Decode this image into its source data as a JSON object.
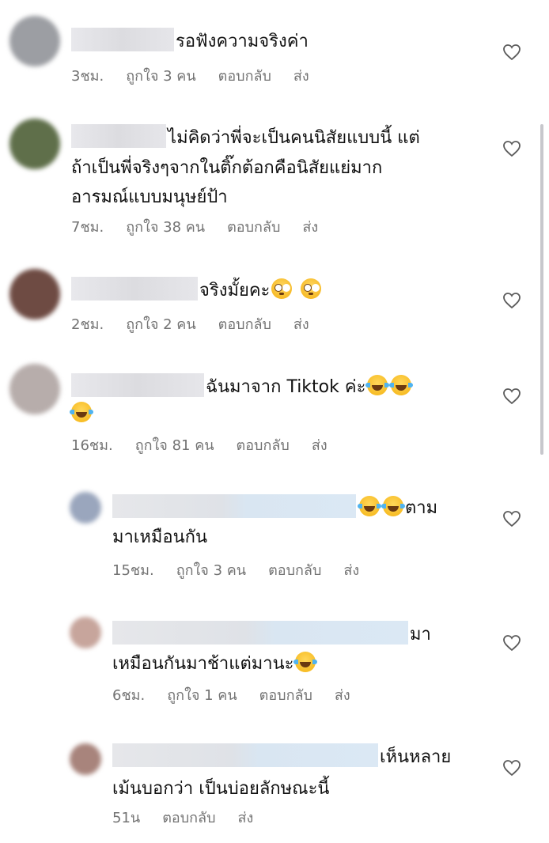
{
  "comments": [
    {
      "text": "รอฟังความจริงค่า",
      "time": "3ชม.",
      "likes": "ถูกใจ 3 คน",
      "reply": "ตอบกลับ",
      "send": "ส่ง",
      "avatar_color": "#9c9ea3"
    },
    {
      "text_lines": [
        "ไม่คิดว่าพี่จะเป็นคนนิสัยแบบนี้ แต่",
        "ถ้าเป็นพี่จริงๆจากในติ๊กต้อกคือนิสัยแย่มาก",
        "อารมณ์แบบมนุษย์ป้า"
      ],
      "time": "7ชม.",
      "likes": "ถูกใจ 38 คน",
      "reply": "ตอบกลับ",
      "send": "ส่ง",
      "avatar_color": "#5f6f4a"
    },
    {
      "text": "จริงมั้ยคะ",
      "emoji": [
        "flushed-face-emoji",
        "flushed-face-emoji"
      ],
      "time": "2ชม.",
      "likes": "ถูกใจ 2 คน",
      "reply": "ตอบกลับ",
      "send": "ส่ง",
      "avatar_color": "#6e4b43"
    },
    {
      "text": "ฉันมาจาก Tiktok ค่ะ",
      "emoji": [
        "tears-of-joy-emoji",
        "tears-of-joy-emoji",
        "tears-of-joy-emoji"
      ],
      "time": "16ชม.",
      "likes": "ถูกใจ 81 คน",
      "reply": "ตอบกลับ",
      "send": "ส่ง",
      "avatar_color": "#b7adab"
    }
  ],
  "replies": [
    {
      "text_lines": [
        "ตาม",
        "มาเหมือนกัน"
      ],
      "emoji": [
        "tears-of-joy-emoji",
        "tears-of-joy-emoji"
      ],
      "time": "15ชม.",
      "likes": "ถูกใจ 3 คน",
      "reply": "ตอบกลับ",
      "send": "ส่ง",
      "avatar_color": "#9aa6bd"
    },
    {
      "text_lines": [
        "มา",
        "เหมือนกันมาช้าแต่มานะ"
      ],
      "emoji": [
        "tears-of-joy-emoji"
      ],
      "time": "6ชม.",
      "likes": "ถูกใจ 1 คน",
      "reply": "ตอบกลับ",
      "send": "ส่ง",
      "avatar_color": "#c7a59c"
    },
    {
      "text_lines": [
        "เห็นหลาย",
        "เม้นบอกว่า เป็นบ่อยลักษณะนี้"
      ],
      "time": "51น",
      "reply": "ตอบกลับ",
      "send": "ส่ง",
      "avatar_color": "#a8847c"
    }
  ],
  "icons": {
    "like": "heart-outline-icon"
  }
}
